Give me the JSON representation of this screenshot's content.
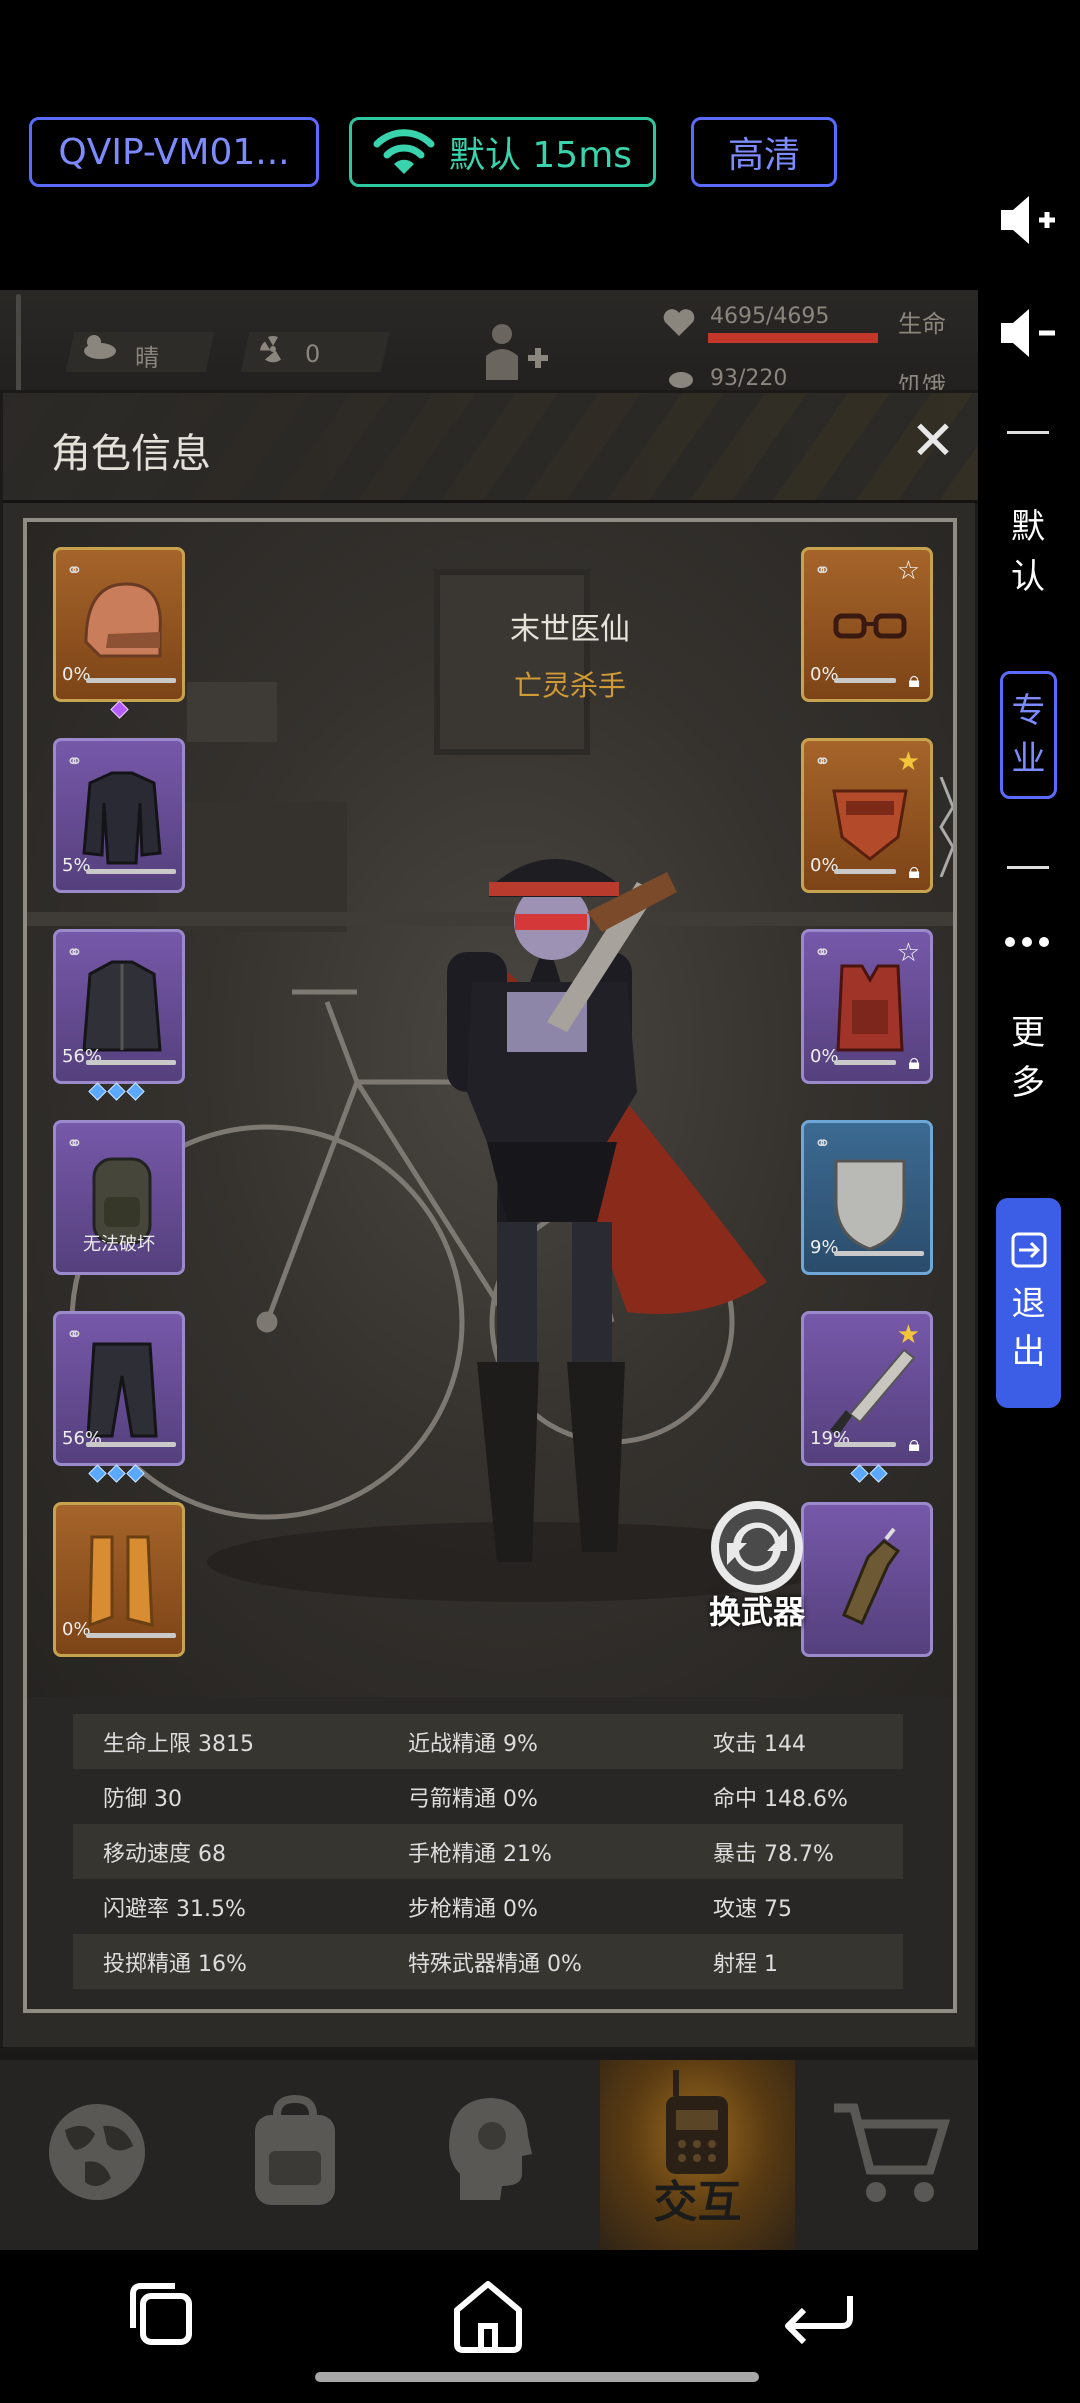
{
  "topbar": {
    "vm_label": "QVIP-VM01...",
    "network_label": "默认 15ms",
    "quality_label": "高清",
    "accent_color": "#5b6bff",
    "network_color": "#39d4ad"
  },
  "side_panel": {
    "volume_up_icon": "volume-up-icon",
    "volume_down_icon": "volume-down-icon",
    "default_label_1": "默",
    "default_label_2": "认",
    "pro_label_1": "专",
    "pro_label_2": "业",
    "more_label_1": "更",
    "more_label_2": "多",
    "exit_label_1": "退",
    "exit_label_2": "出"
  },
  "hud": {
    "weather": "晴",
    "radiation": "0",
    "hp": "4695/4695",
    "hp_label": "生命",
    "hunger": "93/220",
    "hunger_label": "饥饿"
  },
  "panel": {
    "title": "角色信息",
    "character_name": "末世医仙",
    "character_title": "亡灵杀手",
    "swap_weapon_label": "换武器"
  },
  "slots_left": [
    {
      "name": "helmet",
      "percent": "0%",
      "gems": 1
    },
    {
      "name": "jacket",
      "percent": "5%",
      "gems": 0
    },
    {
      "name": "coat",
      "percent": "56%",
      "gems": 3
    },
    {
      "name": "backpack",
      "percent": "",
      "note": "无法破坏",
      "gems": 0
    },
    {
      "name": "pants",
      "percent": "56%",
      "gems": 3
    },
    {
      "name": "boots",
      "percent": "0%",
      "gems": 0
    }
  ],
  "slots_right": [
    {
      "name": "goggles",
      "percent": "0%"
    },
    {
      "name": "mask",
      "percent": "0%"
    },
    {
      "name": "vest",
      "percent": "0%"
    },
    {
      "name": "shield",
      "percent": "9%"
    },
    {
      "name": "machete",
      "percent": "19%",
      "gems": 2
    },
    {
      "name": "molotov",
      "percent": ""
    }
  ],
  "stats": [
    [
      "生命上限 3815",
      "近战精通 9%",
      "攻击 144"
    ],
    [
      "防御 30",
      "弓箭精通 0%",
      "命中 148.6%"
    ],
    [
      "移动速度 68",
      "手枪精通 21%",
      "暴击 78.7%"
    ],
    [
      "闪避率 31.5%",
      "步枪精通 0%",
      "攻速 75"
    ],
    [
      "投掷精通 16%",
      "特殊武器精通 0%",
      "射程 1"
    ]
  ],
  "game_nav": {
    "active_label": "交互",
    "items": [
      "world-map-icon",
      "backpack-icon",
      "skills-head-icon",
      "interact-radio-icon",
      "shop-cart-icon"
    ]
  },
  "android_nav": [
    "recents-icon",
    "home-icon",
    "back-icon"
  ]
}
